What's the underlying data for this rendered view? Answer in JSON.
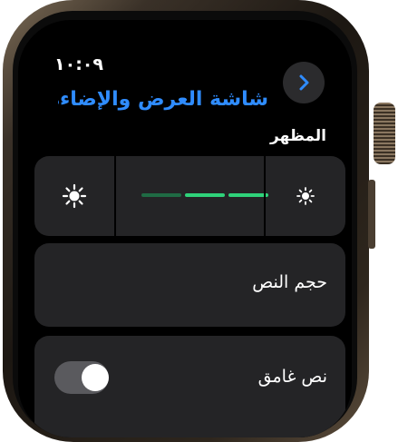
{
  "status": {
    "time": "١٠:٠٩"
  },
  "header": {
    "title": "شاشة العرض والإضاءة",
    "back_icon": "chevron-icon"
  },
  "appearance": {
    "label": "المظهر",
    "decrease_icon": "sun-small-icon",
    "increase_icon": "sun-large-icon",
    "level_steps": 3,
    "level_value": 2,
    "active_color": "#2fd27a",
    "inactive_color": "#1f6b44"
  },
  "text_size": {
    "label": "حجم النص"
  },
  "bold_text": {
    "label": "نص غامق",
    "enabled": false
  }
}
